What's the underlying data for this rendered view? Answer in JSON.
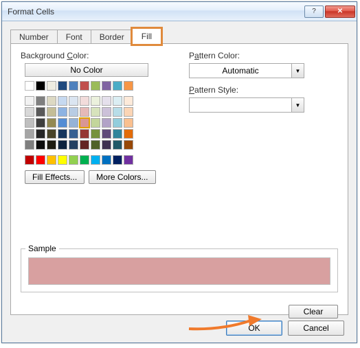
{
  "window": {
    "title": "Format Cells"
  },
  "titlebar": {
    "help_glyph": "?",
    "close_glyph": "✕"
  },
  "tabs": [
    {
      "label": "Number"
    },
    {
      "label": "Font"
    },
    {
      "label": "Border"
    },
    {
      "label": "Fill"
    }
  ],
  "active_tab_index": 3,
  "fill": {
    "bg_label_prefix": "Background ",
    "bg_label_ul": "C",
    "bg_label_suffix": "olor:",
    "no_color_prefix": "",
    "no_color_ul": "N",
    "no_color_suffix": "o Color",
    "pattern_color_label_prefix": "P",
    "pattern_color_label_ul": "a",
    "pattern_color_label_suffix": "ttern Color:",
    "pattern_color_value": "Automatic",
    "pattern_style_label_prefix": "",
    "pattern_style_label_ul": "P",
    "pattern_style_label_suffix": "attern Style:",
    "pattern_style_value": "",
    "fill_effects_label_prefix": "F",
    "fill_effects_label_ul": "i",
    "fill_effects_label_suffix": "ll Effects...",
    "more_colors_label_prefix": "",
    "more_colors_label_ul": "M",
    "more_colors_label_suffix": "ore Colors...",
    "sample_label": "Sample",
    "selected_color": "#d8a0a0"
  },
  "palette": {
    "row0": [
      "#ffffff",
      "#000000",
      "#eeece1",
      "#1f497d",
      "#4f81bd",
      "#c0504d",
      "#9bbb59",
      "#8064a2",
      "#4bacc6",
      "#f79646"
    ],
    "rows_mid": [
      [
        "#f2f2f2",
        "#7f7f7f",
        "#ddd9c3",
        "#c6d9f0",
        "#dbe5f1",
        "#f2dcdb",
        "#ebf1dd",
        "#e5e0ec",
        "#dbeef3",
        "#fdeada"
      ],
      [
        "#d8d8d8",
        "#595959",
        "#c4bd97",
        "#8db3e2",
        "#b8cce4",
        "#e5b9b7",
        "#d7e3bc",
        "#ccc1d9",
        "#b7dde8",
        "#fbd5b5"
      ],
      [
        "#bfbfbf",
        "#3f3f3f",
        "#938953",
        "#548dd4",
        "#95b3d7",
        "#d99694",
        "#c3d69b",
        "#b2a2c7",
        "#92cddc",
        "#fac08f"
      ],
      [
        "#a5a5a5",
        "#262626",
        "#494429",
        "#17365d",
        "#366092",
        "#953734",
        "#76923c",
        "#5f497a",
        "#31859b",
        "#e36c09"
      ],
      [
        "#7f7f7f",
        "#0c0c0c",
        "#1d1b10",
        "#0f243e",
        "#244061",
        "#632423",
        "#4f6128",
        "#3f3151",
        "#205867",
        "#974806"
      ]
    ],
    "row_last": [
      "#c00000",
      "#ff0000",
      "#ffc000",
      "#ffff00",
      "#92d050",
      "#00b050",
      "#00b0f0",
      "#0070c0",
      "#002060",
      "#7030a0"
    ],
    "selected_hex": "#d99694"
  },
  "buttons": {
    "clear": "Clear",
    "ok": "OK",
    "cancel": "Cancel"
  }
}
